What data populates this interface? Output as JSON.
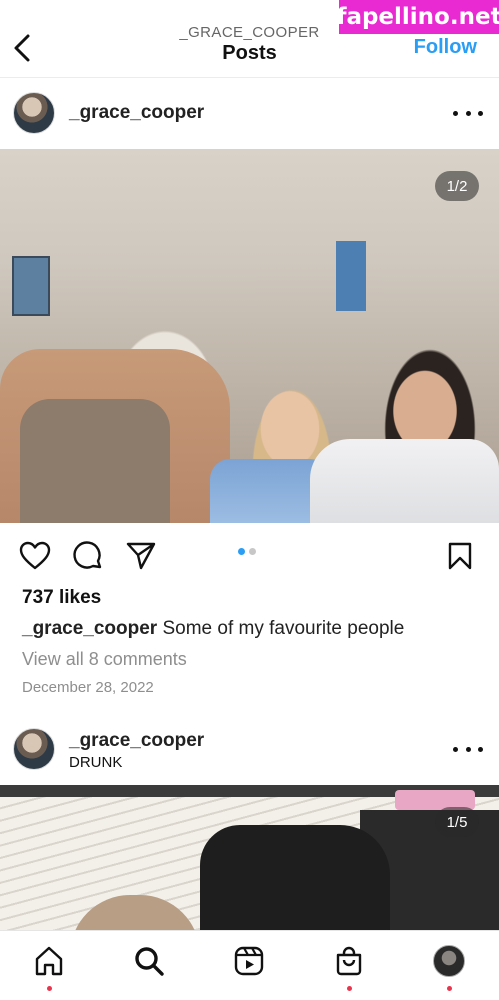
{
  "header": {
    "username": "_GRACE_COOPER",
    "title": "Posts",
    "follow_label": "Follow"
  },
  "watermark": "fapellino.net",
  "posts": [
    {
      "username": "_grace_cooper",
      "counter": "1/2",
      "likes": "737 likes",
      "caption_user": "_grace_cooper",
      "caption_text": " Some of my favourite people",
      "comments": "View all 8 comments",
      "date": "December 28, 2022",
      "carousel_active": 0,
      "carousel_count": 2
    },
    {
      "username": "_grace_cooper",
      "subline": "DRUNK",
      "counter": "1/5"
    }
  ],
  "icons": {
    "back": "chevron-left-icon",
    "more": "more-horizontal-icon",
    "like": "heart-icon",
    "comment": "comment-icon",
    "share": "send-icon",
    "save": "bookmark-icon",
    "tabs": [
      "home-icon",
      "search-icon",
      "reels-icon",
      "shop-icon",
      "profile-icon"
    ]
  },
  "colors": {
    "accent": "#2a9df4",
    "watermark_bg": "#e92ad3",
    "notification_dot": "#e8344c"
  }
}
